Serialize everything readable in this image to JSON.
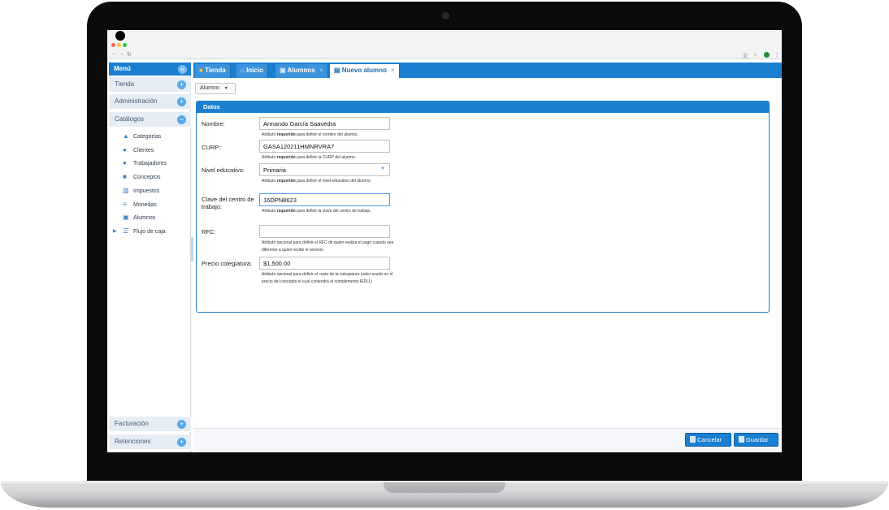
{
  "sidebar": {
    "menu_title": "Menú",
    "sections": {
      "tienda": "Tienda",
      "administracion": "Administración",
      "catalogos": "Catálogos",
      "facturacion": "Facturación",
      "retenciones": "Retenciones"
    },
    "catalog_items": [
      {
        "label": "Categorías",
        "icon": "graduation-cap-icon"
      },
      {
        "label": "Clientes",
        "icon": "users-icon"
      },
      {
        "label": "Trabajadores",
        "icon": "user-icon"
      },
      {
        "label": "Conceptos",
        "icon": "box-icon"
      },
      {
        "label": "Impuestos",
        "icon": "bank-icon"
      },
      {
        "label": "Monedas",
        "icon": "coins-icon"
      },
      {
        "label": "Alumnos",
        "icon": "student-icon"
      },
      {
        "label": "Flujo de caja",
        "icon": "list-icon"
      }
    ]
  },
  "tabs": [
    {
      "label": "Tienda",
      "icon": "store-icon"
    },
    {
      "label": "Inicio",
      "icon": "home-icon"
    },
    {
      "label": "Alumnos",
      "icon": "student-icon",
      "close": "×"
    },
    {
      "label": "Nuevo alumno",
      "icon": "form-icon",
      "close": "×"
    }
  ],
  "toolbar": {
    "entity_select": "Alumno"
  },
  "panel": {
    "title": "Datos"
  },
  "form": {
    "nombre": {
      "label": "Nombre:",
      "value": "Armando García Saavedra",
      "hint_pre": "Atributo ",
      "hint_bold": "requerido",
      "hint_post": " para definir el nombre del alumno."
    },
    "curp": {
      "label": "CURP:",
      "value": "GASA120211HMNRVRA7",
      "hint_pre": "Atributo ",
      "hint_bold": "requerido",
      "hint_post": " para definir la CURP del alumno."
    },
    "nivel": {
      "label": "Nivel educativo:",
      "value": "Primaria",
      "hint_pre": "Atributo ",
      "hint_bold": "requerido",
      "hint_post": " para definir el nivel educativo del alumno."
    },
    "clave": {
      "label": "Clave del centro de trabajo:",
      "value": "16DPN8623",
      "hint_pre": "Atributo ",
      "hint_bold": "requerido",
      "hint_post": " para definir la clave del centro de trabajo."
    },
    "rfc": {
      "label": "RFC:",
      "value": "",
      "hint": "Atributo opcional para definir el RFC de quien realiza el pago cuando sea diferente a quien recibe el servicio."
    },
    "precio": {
      "label": "Precio colegiatura:",
      "value": "$1,500.00",
      "hint": "Atributo opcional para definir el costo de la colegiatura (valor usado en el precio del concepto el cual contendrá el complemento IEDU.)"
    }
  },
  "footer": {
    "cancel_label": "Cancelar",
    "save_label": "Guardar"
  },
  "colors": {
    "accent": "#1a7fd1",
    "sidebar_section_bg": "#e6edf5"
  }
}
